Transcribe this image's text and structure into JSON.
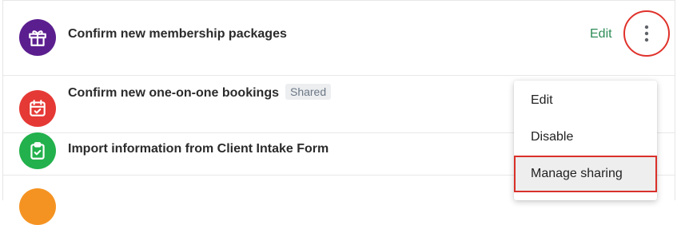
{
  "rows": [
    {
      "title": "Confirm new membership packages",
      "tag": "",
      "icon": "gift-icon",
      "color": "#5b1e8f"
    },
    {
      "title": "Confirm new one-on-one bookings",
      "tag": "Shared",
      "icon": "calendar-check-icon",
      "color": "#e53935"
    },
    {
      "title": "Import information from Client Intake Form",
      "tag": "",
      "icon": "clipboard-check-icon",
      "color": "#22b14c"
    },
    {
      "title": "",
      "tag": "",
      "icon": "orange-icon",
      "color": "#f59322"
    }
  ],
  "row_actions": {
    "edit_label": "Edit",
    "more_icon": "kebab-menu-icon"
  },
  "menu": {
    "items": [
      {
        "label": "Edit"
      },
      {
        "label": "Disable"
      },
      {
        "label": "Manage sharing",
        "highlighted": true
      }
    ]
  },
  "colors": {
    "link": "#2e8b57",
    "highlight_border": "#d9302a"
  }
}
